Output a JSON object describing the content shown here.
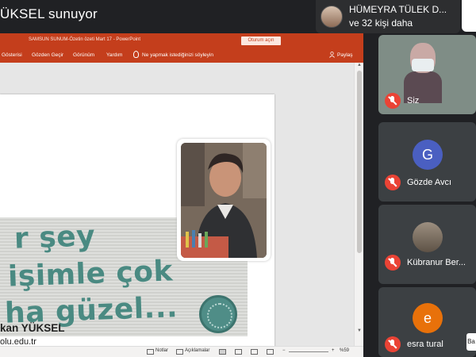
{
  "presenter": {
    "title": "ÜKSEL sunuyor"
  },
  "notice": {
    "line1": "HÜMEYRA TÜLEK D...",
    "line2": "ve 32 kişi daha"
  },
  "ppt": {
    "doc_title": "SAMSUN SUNUM-Özetin özeti Mart 17  -  PowerPoint",
    "signin_label": "Oturum açın",
    "tabs": [
      "Gösterisi",
      "Gözden Geçir",
      "Görünüm",
      "Yardım"
    ],
    "tell_me": "Ne yapmak istediğinizi söyleyin",
    "share_label": "Paylaş",
    "status": {
      "notes": "Notlar",
      "comments": "Açıklamalar",
      "zoom": "%59"
    }
  },
  "slide": {
    "quote_lines": [
      "r şey",
      "işimle çok",
      "ha güzel..."
    ],
    "name": "kan YÜKSEL",
    "email": "olu.edu.tr"
  },
  "participants": [
    {
      "name": "Siz",
      "type": "video",
      "muted": true
    },
    {
      "name": "Gözde Avcı",
      "type": "initial",
      "initial": "G",
      "color": "#4a5fc1",
      "muted": true
    },
    {
      "name": "Kübranur Ber...",
      "type": "photo",
      "muted": true
    },
    {
      "name": "esra tural",
      "type": "initial",
      "initial": "e",
      "color": "#e8710a",
      "muted": true
    }
  ],
  "side_button": "Ba"
}
